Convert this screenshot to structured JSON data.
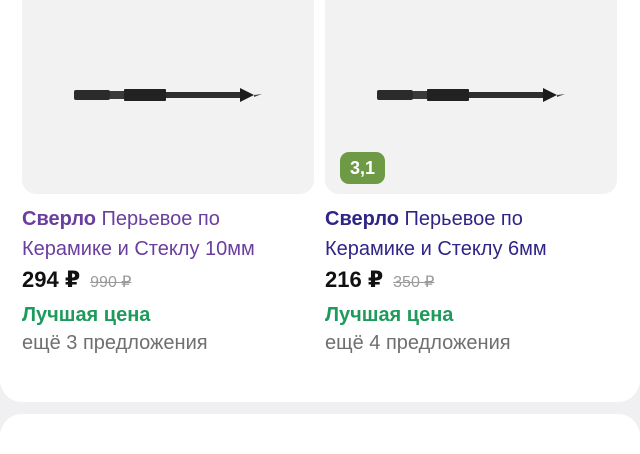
{
  "products": [
    {
      "brand": "Сверло",
      "title": "Перьевое по Керамике и Стеклу 10мм",
      "price": "294 ₽",
      "old_price": "990 ₽",
      "badge_text": "Лучшая цена",
      "offers_text": "ещё 3 предложения",
      "image_icon": "drill-bit-icon"
    },
    {
      "brand": "Сверло",
      "title": "Перьевое по Керамике и Стеклу 6мм",
      "price": "216 ₽",
      "old_price": "350 ₽",
      "rating": "3,1",
      "badge_text": "Лучшая цена",
      "offers_text": "ещё 4 предложения",
      "image_icon": "drill-bit-icon"
    }
  ],
  "colors": {
    "title_purple": "#6a3e9e",
    "title_blue": "#2f2587",
    "best_price_green": "#1e9a5c",
    "rating_green": "#6e9a46",
    "image_bg": "#f2f2f3",
    "page_bg": "#f0f0f3"
  }
}
